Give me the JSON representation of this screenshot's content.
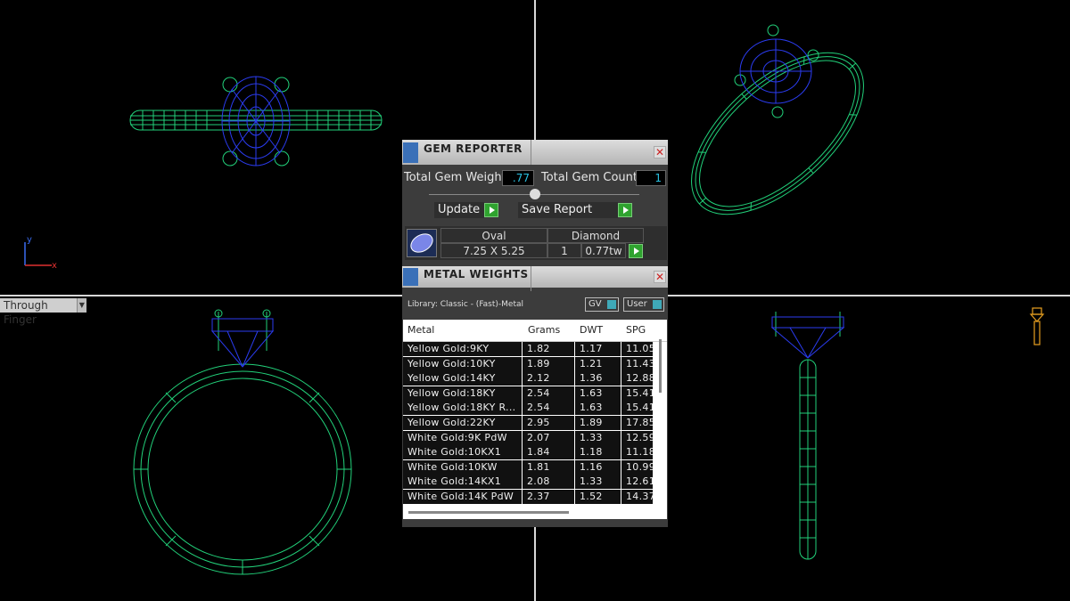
{
  "viewport": {
    "view_label": "Through Finger",
    "axis_y": "y",
    "axis_x": "x"
  },
  "gem_reporter": {
    "title": "GEM REPORTER",
    "total_weight_label": "Total Gem Weight",
    "total_weight_value": ".77",
    "total_count_label": "Total Gem Count",
    "total_count_value": "1",
    "update_label": "Update",
    "save_report_label": "Save Report",
    "gem": {
      "shape": "Oval",
      "size": "7.25 X 5.25",
      "material": "Diamond",
      "count": "1",
      "weight": "0.77tw"
    }
  },
  "metal_weights": {
    "title": "METAL WEIGHTS",
    "library": "Library: Classic - (Fast)-Metal",
    "gv_label": "GV",
    "user_label": "User",
    "columns": [
      "Metal",
      "Grams",
      "DWT",
      "SPG"
    ],
    "rows": [
      [
        "Yellow Gold:9KY",
        "1.82",
        "1.17",
        "11.05"
      ],
      [
        "Yellow Gold:10KY",
        "1.89",
        "1.21",
        "11.43"
      ],
      [
        "Yellow Gold:14KY",
        "2.12",
        "1.36",
        "12.88"
      ],
      [
        "Yellow Gold:18KY",
        "2.54",
        "1.63",
        "15.41"
      ],
      [
        "Yellow Gold:18KY R...",
        "2.54",
        "1.63",
        "15.41"
      ],
      [
        "Yellow Gold:22KY",
        "2.95",
        "1.89",
        "17.85"
      ],
      [
        "White Gold:9K PdW",
        "2.07",
        "1.33",
        "12.59"
      ],
      [
        "White Gold:10KX1",
        "1.84",
        "1.18",
        "11.18"
      ],
      [
        "White Gold:10KW",
        "1.81",
        "1.16",
        "10.99"
      ],
      [
        "White Gold:14KX1",
        "2.08",
        "1.33",
        "12.61"
      ],
      [
        "White Gold:14K PdW",
        "2.37",
        "1.52",
        "14.37"
      ]
    ]
  },
  "colors": {
    "wire_green": "#22d17a",
    "wire_blue": "#2b3cf0",
    "accent_cyan": "#29c0e0",
    "gizmo_orange": "#e8a020"
  }
}
